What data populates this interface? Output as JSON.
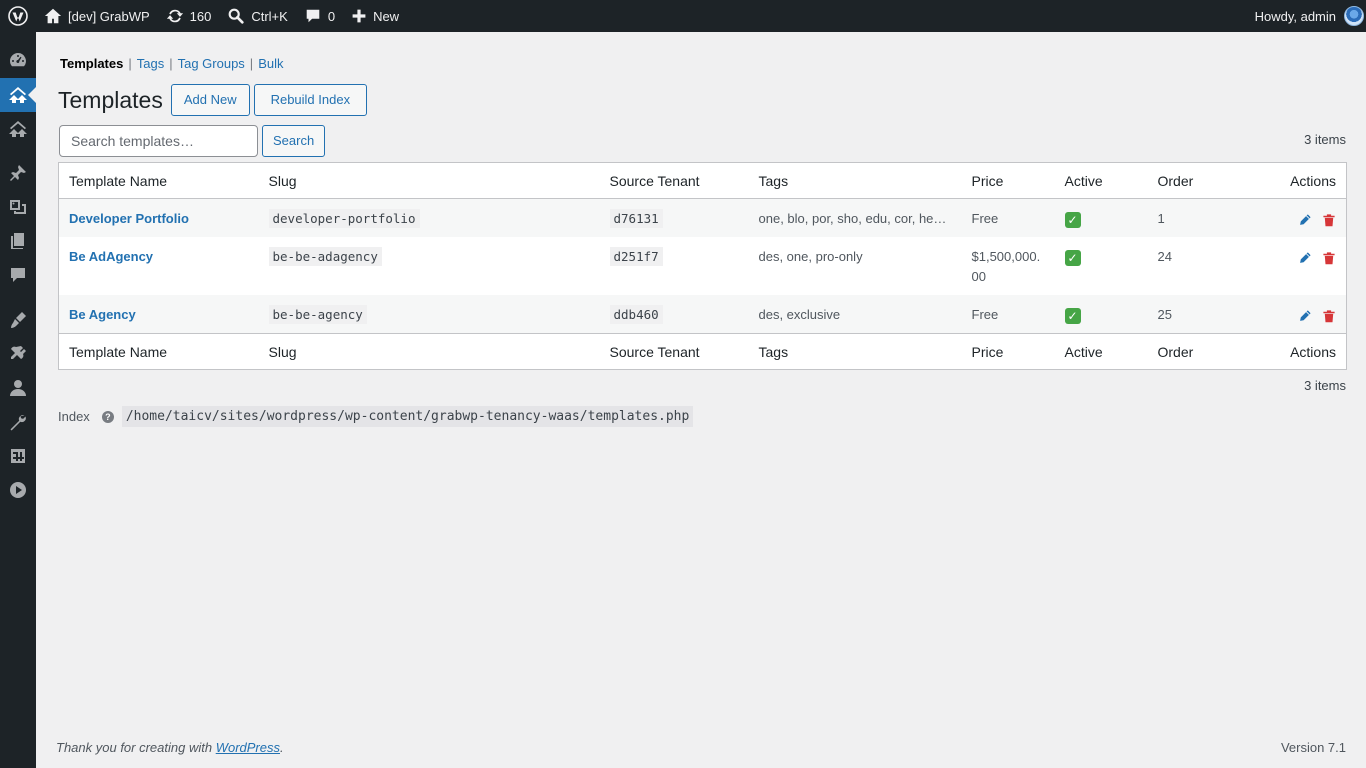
{
  "adminbar": {
    "site_name": "[dev] GrabWP",
    "updates_count": "160",
    "search_shortcut": "Ctrl+K",
    "comments_count": "0",
    "new_label": "New",
    "howdy": "Howdy, admin"
  },
  "sidebar": {
    "items": [
      "dashboard-icon",
      "grabwp-tenancy-icon",
      "grabwp-icon",
      "posts-icon",
      "media-icon",
      "pages-icon",
      "comments-icon",
      "appearance-icon",
      "plugins-icon",
      "users-icon",
      "tools-icon",
      "settings-icon",
      "play-icon"
    ]
  },
  "subnav": {
    "items": [
      {
        "label": "Templates",
        "current": true
      },
      {
        "label": "Tags",
        "current": false
      },
      {
        "label": "Tag Groups",
        "current": false
      },
      {
        "label": "Bulk",
        "current": false
      }
    ]
  },
  "page": {
    "title": "Templates",
    "add_new": "Add New",
    "rebuild_index": "Rebuild Index"
  },
  "search": {
    "placeholder": "Search templates…",
    "button": "Search"
  },
  "items_count": "3 items",
  "table": {
    "columns": [
      "Template Name",
      "Slug",
      "Source Tenant",
      "Tags",
      "Price",
      "Active",
      "Order",
      "Actions"
    ],
    "rows": [
      {
        "name": "Developer Portfolio",
        "slug": "developer-portfolio",
        "source": "d76131",
        "tags": "one, blo, por, sho, edu, cor, hea…",
        "price": "Free",
        "active": true,
        "order": "1"
      },
      {
        "name": "Be AdAgency",
        "slug": "be-be-adagency",
        "source": "d251f7",
        "tags": "des, one, pro-only",
        "price": "$1,500,000.00",
        "active": true,
        "order": "24"
      },
      {
        "name": "Be Agency",
        "slug": "be-be-agency",
        "source": "ddb460",
        "tags": "des, exclusive",
        "price": "Free",
        "active": true,
        "order": "25"
      }
    ]
  },
  "index": {
    "label": "Index",
    "path": "/home/taicv/sites/wordpress/wp-content/grabwp-tenancy-waas/templates.php"
  },
  "footer": {
    "thanks": "Thank you for creating with ",
    "wordpress_link": "WordPress",
    "thanks_end": ".",
    "version": "Version 7.1"
  },
  "colors": {
    "accent": "#2271b1",
    "adminbar_bg": "#1d2327",
    "delete": "#d63638",
    "active": "#46a546"
  }
}
